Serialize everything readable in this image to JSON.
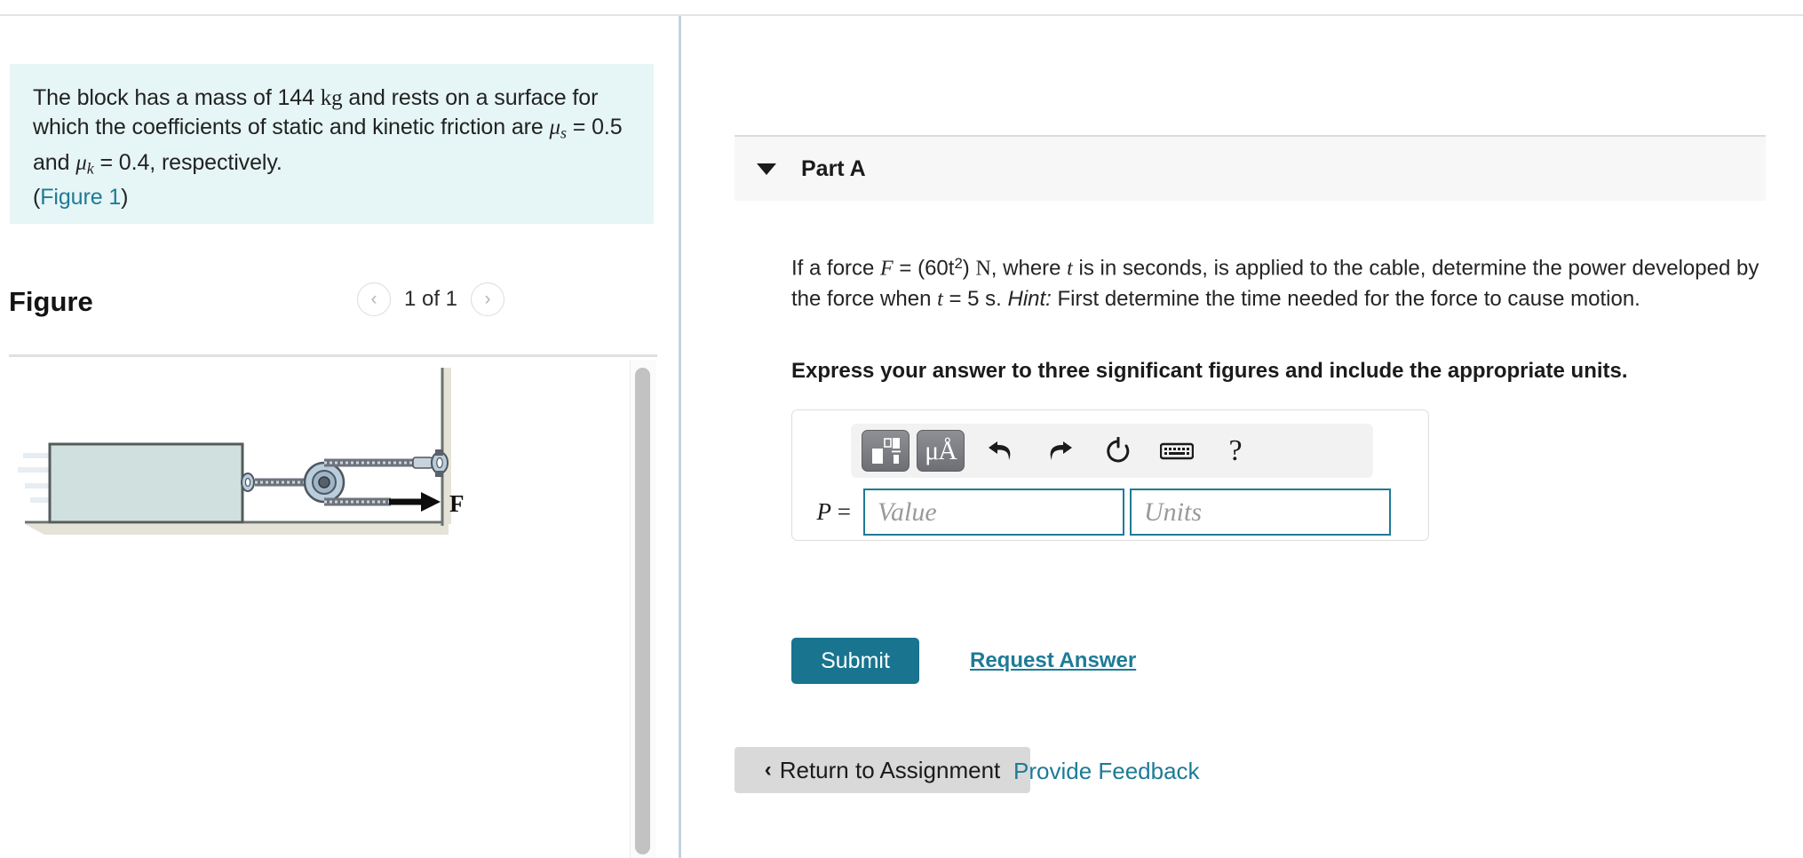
{
  "problem": {
    "text_part1": "The block has a mass of 144 ",
    "unit_kg": "kg",
    "text_part2": " and rests on a surface for which the coefficients of static and kinetic friction are ",
    "mu_s_symbol": "μ",
    "mu_s_sub": "s",
    "mu_s_eq": " = 0.5 and ",
    "mu_k_symbol": "μ",
    "mu_k_sub": "k",
    "mu_k_eq": " = 0.4, respectively.",
    "figure_link_open": "(",
    "figure_link": "Figure 1",
    "figure_link_close": ")"
  },
  "figure": {
    "title": "Figure",
    "pager_label": "1 of 1",
    "prev_icon": "chevron-left-icon",
    "next_icon": "chevron-right-icon",
    "prev_glyph": "‹",
    "next_glyph": "›",
    "force_label": "F",
    "block_fill": "#cfe0df",
    "block_stroke": "#555b5b",
    "ground_color": "#e5e3d8",
    "cable_color": "#8a8f96",
    "pulley_color": "#b9cddd"
  },
  "part": {
    "caret_icon": "caret-down-icon",
    "title": "Part A",
    "question_seg1": "If a force ",
    "question_F": "F",
    "question_seg2": " = (60t",
    "question_exp": "2",
    "question_seg3": ") ",
    "question_N": "N",
    "question_seg4": ", where ",
    "question_t1": "t",
    "question_seg5": " is in seconds, is applied to the cable, determine the power developed by the force when ",
    "question_t2": "t",
    "question_seg6": " = 5 s. ",
    "question_hint": "Hint:",
    "question_seg7": " First determine the time needed for the force to cause motion.",
    "express_line": "Express your answer to three significant figures and include the appropriate units."
  },
  "answer": {
    "toolbar": [
      {
        "name": "math-template-icon",
        "kind": "template",
        "label": ""
      },
      {
        "name": "units-micro-angstrom-icon",
        "kind": "units",
        "label": "μÅ"
      },
      {
        "name": "undo-icon",
        "kind": "undo",
        "label": ""
      },
      {
        "name": "redo-icon",
        "kind": "redo",
        "label": ""
      },
      {
        "name": "reset-icon",
        "kind": "reset",
        "label": ""
      },
      {
        "name": "keyboard-icon",
        "kind": "keyboard",
        "label": ""
      },
      {
        "name": "help-icon",
        "kind": "help",
        "label": "?"
      }
    ],
    "label_var": "P",
    "label_eq": " =",
    "value_placeholder": "Value",
    "value_text": "",
    "units_placeholder": "Units",
    "units_text": "",
    "submit_label": "Submit",
    "request_answer_label": "Request Answer",
    "accent_color": "#18748f",
    "field_border_color": "#1e7b96"
  },
  "footer": {
    "return_chevron": "‹",
    "return_label": "Return to Assignment",
    "feedback_label": "Provide Feedback"
  }
}
